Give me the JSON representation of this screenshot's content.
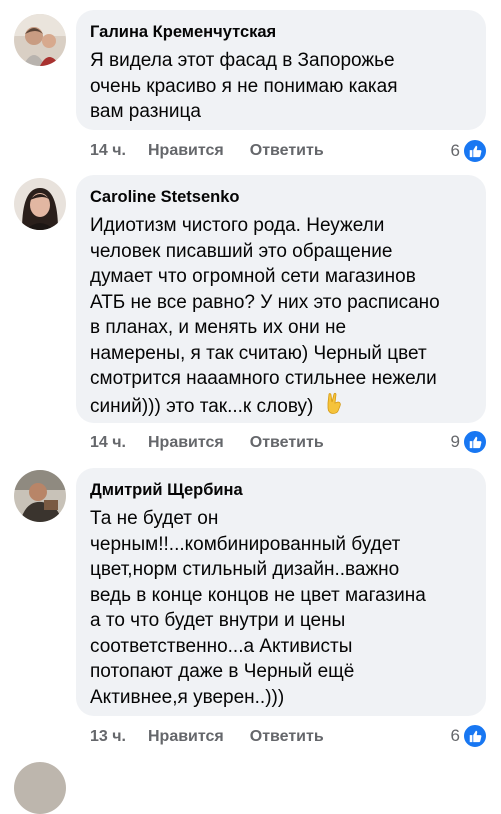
{
  "comments": [
    {
      "author": "Галина Кременчутская",
      "lines": [
        "Я видела этот фасад в Запорожье",
        "очень красиво  я не понимаю  какая",
        "вам разница"
      ],
      "time": "14 ч.",
      "like_label": "Нравится",
      "reply_label": "Ответить",
      "reaction_count": "6",
      "avatar_icon": "profile-photo-two-people"
    },
    {
      "author": "Caroline Stetsenko",
      "lines": [
        "Идиотизм чистого рода. Неужели",
        "человек писавший это обращение",
        "думает что огромной сети магазинов",
        "АТБ не все равно? У них это расписано",
        "в планах, и менять их они не",
        "намерены, я так считаю) Черный цвет",
        "смотрится нааамного стильнее нежели",
        "синий))) это так...к слову)"
      ],
      "emoji": "victory-hand-icon",
      "time": "14 ч.",
      "like_label": "Нравится",
      "reply_label": "Ответить",
      "reaction_count": "9",
      "avatar_icon": "profile-photo-woman"
    },
    {
      "author": "Дмитрий Щербина",
      "lines": [
        "Та не будет он",
        "черным!!...комбинированный будет",
        "цвет,норм стильный дизайн..важно",
        "ведь в конце концов не цвет магазина",
        "а то что будет внутри и цены",
        "соответственно...а Активисты",
        "потопают даже в Черный ещё",
        "Активнее,я уверен..)))"
      ],
      "time": "13 ч.",
      "like_label": "Нравится",
      "reply_label": "Ответить",
      "reaction_count": "6",
      "avatar_icon": "profile-photo-man"
    }
  ],
  "colors": {
    "bubble": "#f0f2f5",
    "text": "#050505",
    "meta": "#65676b",
    "like_blue": "#1877f2"
  }
}
